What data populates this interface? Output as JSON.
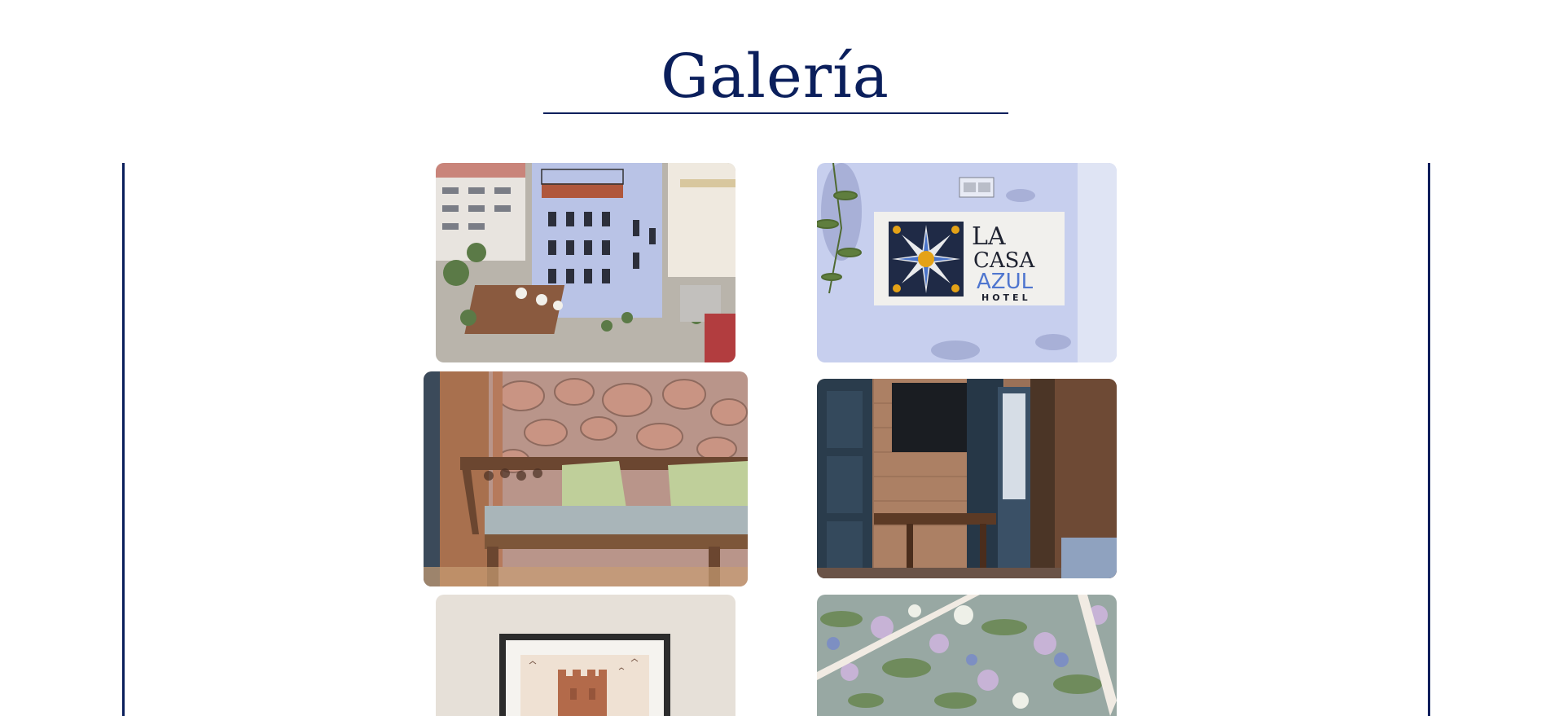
{
  "gallery": {
    "title": "Galería",
    "accent_color": "#0b1f5c",
    "photos": [
      {
        "subject": "aerial-view-hotel-building-photo",
        "alt": "Vista aérea del hotel"
      },
      {
        "subject": "hotel-sign-la-casa-azul-photo",
        "alt": "Letrero La Casa Azul Hotel",
        "sign_lines": [
          "LA",
          "CASA",
          "AZUL",
          "HOTEL"
        ]
      },
      {
        "subject": "wooden-bench-stone-wall-photo",
        "alt": "Banco de madera junto a muro de piedra"
      },
      {
        "subject": "hotel-room-desk-tv-photo",
        "alt": "Habitación con escritorio y televisión"
      },
      {
        "subject": "framed-castle-painting-photo",
        "alt": "Cuadro enmarcado de un castillo"
      },
      {
        "subject": "floral-wallpaper-photo",
        "alt": "Papel pintado floral"
      }
    ]
  }
}
